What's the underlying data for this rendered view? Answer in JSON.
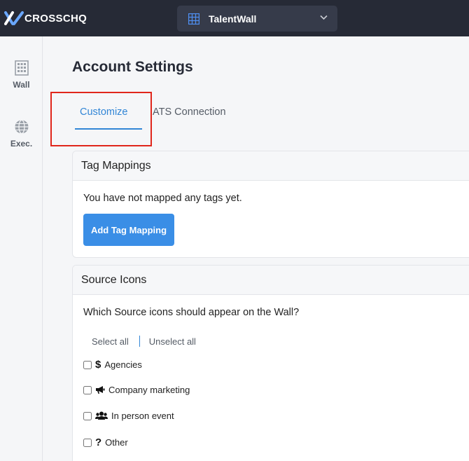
{
  "app": {
    "logo_text": "CROSSCHQ",
    "wall_selector": {
      "label": "TalentWall",
      "icon": "grid-building-icon"
    }
  },
  "sidebar": {
    "items": [
      {
        "label": "Wall",
        "icon": "building-grid-icon"
      },
      {
        "label": "Exec.",
        "icon": "globe-icon"
      }
    ]
  },
  "page": {
    "title": "Account Settings",
    "tabs": [
      {
        "label": "Customize",
        "active": true
      },
      {
        "label": "ATS Connection",
        "active": false
      }
    ]
  },
  "tag_mappings": {
    "header": "Tag Mappings",
    "empty_text": "You have not mapped any tags yet.",
    "add_button": "Add Tag Mapping"
  },
  "source_icons": {
    "header": "Source Icons",
    "question": "Which Source icons should appear on the Wall?",
    "select_all": "Select all",
    "unselect_all": "Unselect all",
    "options": [
      {
        "label": "Agencies",
        "icon": "dollar-icon",
        "glyph": "$",
        "checked": false
      },
      {
        "label": "Company marketing",
        "icon": "megaphone-icon",
        "checked": false
      },
      {
        "label": "In person event",
        "icon": "users-icon",
        "checked": false
      },
      {
        "label": "Other",
        "icon": "question-icon",
        "glyph": "?",
        "checked": false
      }
    ]
  },
  "colors": {
    "topbar": "#262a36",
    "accent": "#3286d6",
    "button": "#3a8ee6",
    "highlight": "#e0261b"
  }
}
